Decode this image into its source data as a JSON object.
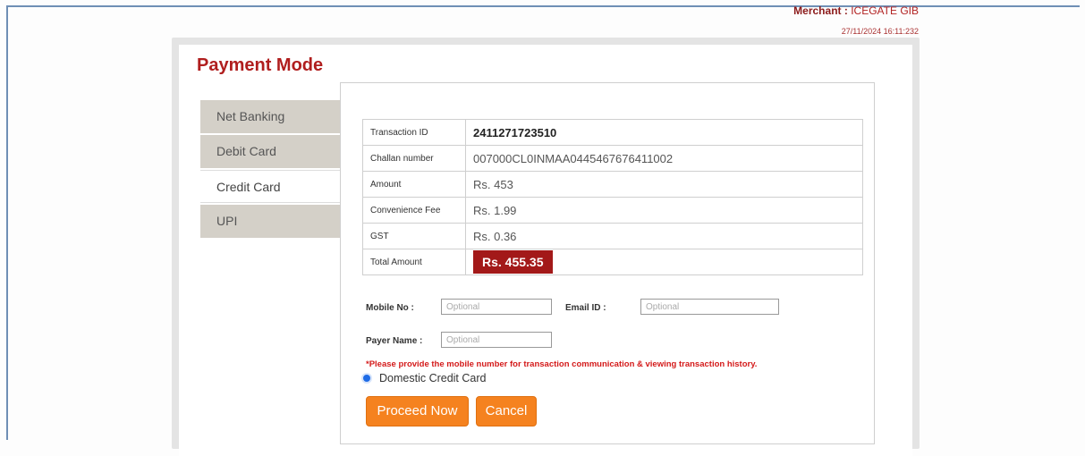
{
  "header": {
    "merchant_label": "Merchant :",
    "merchant_value": "ICEGATE GIB",
    "datetime": "27/11/2024 16:11:232"
  },
  "page": {
    "title": "Payment Mode"
  },
  "tabs": [
    {
      "label": "Net Banking",
      "active": false
    },
    {
      "label": "Debit Card",
      "active": false
    },
    {
      "label": "Credit Card",
      "active": true
    },
    {
      "label": "UPI",
      "active": false
    }
  ],
  "transaction": {
    "rows": [
      {
        "label": "Transaction ID",
        "value": "2411271723510"
      },
      {
        "label": "Challan number",
        "value": "007000CL0INMAA0445467676411002"
      },
      {
        "label": "Amount",
        "value": "Rs. 453"
      },
      {
        "label": "Convenience Fee",
        "value": "Rs. 1.99"
      },
      {
        "label": "GST",
        "value": "Rs. 0.36"
      },
      {
        "label": "Total Amount",
        "value": "Rs. 455.35"
      }
    ]
  },
  "form": {
    "mobile_label": "Mobile No   :",
    "mobile_placeholder": "Optional",
    "email_label": "Email ID     :",
    "email_placeholder": "Optional",
    "payer_label": "Payer Name :",
    "payer_placeholder": "Optional",
    "notice": "*Please provide the mobile number for transaction communication & viewing transaction history.",
    "radio_label": "Domestic Credit Card"
  },
  "buttons": {
    "proceed": "Proceed Now",
    "cancel": "Cancel"
  },
  "colors": {
    "title": "#b01e1e",
    "total_badge": "#a31919",
    "button": "#f5821f",
    "notice": "#d41a1a"
  }
}
